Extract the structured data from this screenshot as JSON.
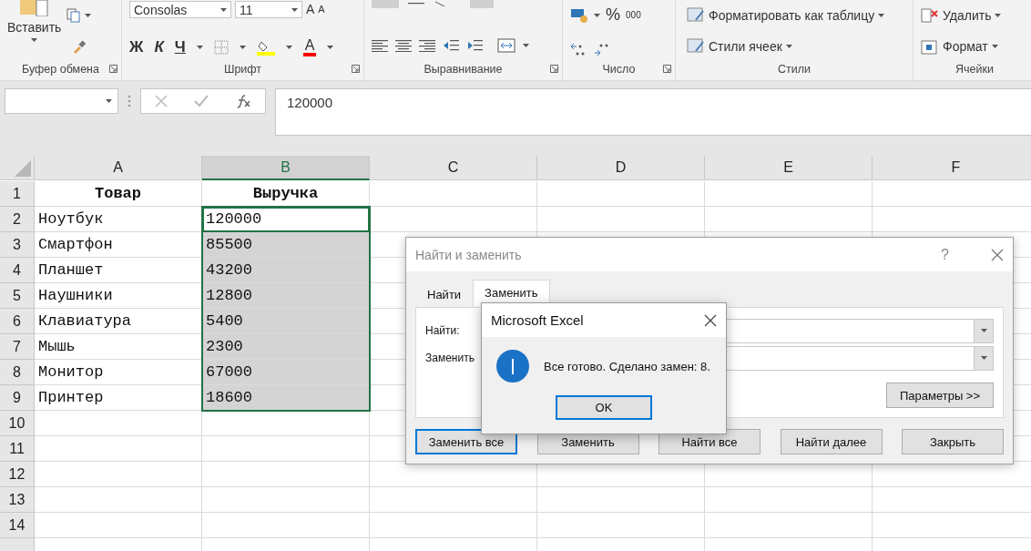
{
  "ribbon": {
    "groups": [
      {
        "kind": "clipboard",
        "label": "Буфер обмена",
        "paste": "Вставить"
      },
      {
        "kind": "font",
        "label": "Шрифт",
        "font_name": "Consolas",
        "font_size": "11",
        "grow": "A",
        "shrink": "A",
        "bold": "Ж",
        "italic": "К",
        "underline": "Ч",
        "font_color": "A"
      },
      {
        "kind": "alignment",
        "label": "Выравнивание"
      },
      {
        "kind": "number",
        "label": "Число",
        "percent": "%",
        "thousands": "000"
      },
      {
        "kind": "styles",
        "label": "Стили",
        "items": [
          "Форматировать как таблицу",
          "Стили ячеек"
        ]
      },
      {
        "kind": "cells",
        "label": "Ячейки",
        "items": [
          "Удалить",
          "Формат"
        ]
      }
    ]
  },
  "formula_bar": {
    "value": "120000"
  },
  "sheet": {
    "columns": [
      {
        "label": "A",
        "selected": false
      },
      {
        "label": "B",
        "selected": true
      },
      {
        "label": "C",
        "selected": false
      },
      {
        "label": "D",
        "selected": false
      },
      {
        "label": "E",
        "selected": false
      },
      {
        "label": "F",
        "selected": false
      }
    ],
    "rows": [
      {
        "number": "1",
        "kind": "header",
        "cells": [
          {
            "text": "Товар",
            "selected": false,
            "active": false
          },
          {
            "text": "Выручка",
            "selected": false,
            "active": false
          }
        ]
      },
      {
        "number": "2",
        "kind": "data",
        "cells": [
          {
            "text": "Ноутбук",
            "selected": false,
            "active": false
          },
          {
            "text": "120000",
            "selected": true,
            "active": true
          }
        ]
      },
      {
        "number": "3",
        "kind": "data",
        "cells": [
          {
            "text": "Смартфон",
            "selected": false,
            "active": false
          },
          {
            "text": "85500",
            "selected": true,
            "active": false
          }
        ]
      },
      {
        "number": "4",
        "kind": "data",
        "cells": [
          {
            "text": "Планшет",
            "selected": false,
            "active": false
          },
          {
            "text": "43200",
            "selected": true,
            "active": false
          }
        ]
      },
      {
        "number": "5",
        "kind": "data",
        "cells": [
          {
            "text": "Наушники",
            "selected": false,
            "active": false
          },
          {
            "text": "12800",
            "selected": true,
            "active": false
          }
        ]
      },
      {
        "number": "6",
        "kind": "data",
        "cells": [
          {
            "text": "Клавиатура",
            "selected": false,
            "active": false
          },
          {
            "text": "5400",
            "selected": true,
            "active": false
          }
        ]
      },
      {
        "number": "7",
        "kind": "data",
        "cells": [
          {
            "text": "Мышь",
            "selected": false,
            "active": false
          },
          {
            "text": "2300",
            "selected": true,
            "active": false
          }
        ]
      },
      {
        "number": "8",
        "kind": "data",
        "cells": [
          {
            "text": "Монитор",
            "selected": false,
            "active": false
          },
          {
            "text": "67000",
            "selected": true,
            "active": false
          }
        ]
      },
      {
        "number": "9",
        "kind": "data",
        "cells": [
          {
            "text": "Принтер",
            "selected": false,
            "active": false
          },
          {
            "text": "18600",
            "selected": true,
            "active": false
          }
        ]
      },
      {
        "number": "10"
      },
      {
        "number": "11"
      },
      {
        "number": "12"
      },
      {
        "number": "13"
      },
      {
        "number": "14"
      }
    ]
  },
  "find_dialog": {
    "title": "Найти и заменить",
    "help": "?",
    "tabs": [
      {
        "label": "Найти",
        "selected": false
      },
      {
        "label": "Заменить",
        "selected": true
      }
    ],
    "fields": [
      {
        "label": "Найти:"
      },
      {
        "label": "Заменить"
      }
    ],
    "options_button": "Параметры >>",
    "buttons": [
      {
        "label": "Заменить все",
        "default": true
      },
      {
        "label": "Заменить",
        "default": false
      },
      {
        "label": "Найти все",
        "default": false
      },
      {
        "label": "Найти далее",
        "default": false
      },
      {
        "label": "Закрыть",
        "default": false
      }
    ]
  },
  "message_box": {
    "title": "Microsoft Excel",
    "message": "Все готово. Сделано замен: 8.",
    "button": {
      "label": "OK",
      "focused": true
    }
  }
}
